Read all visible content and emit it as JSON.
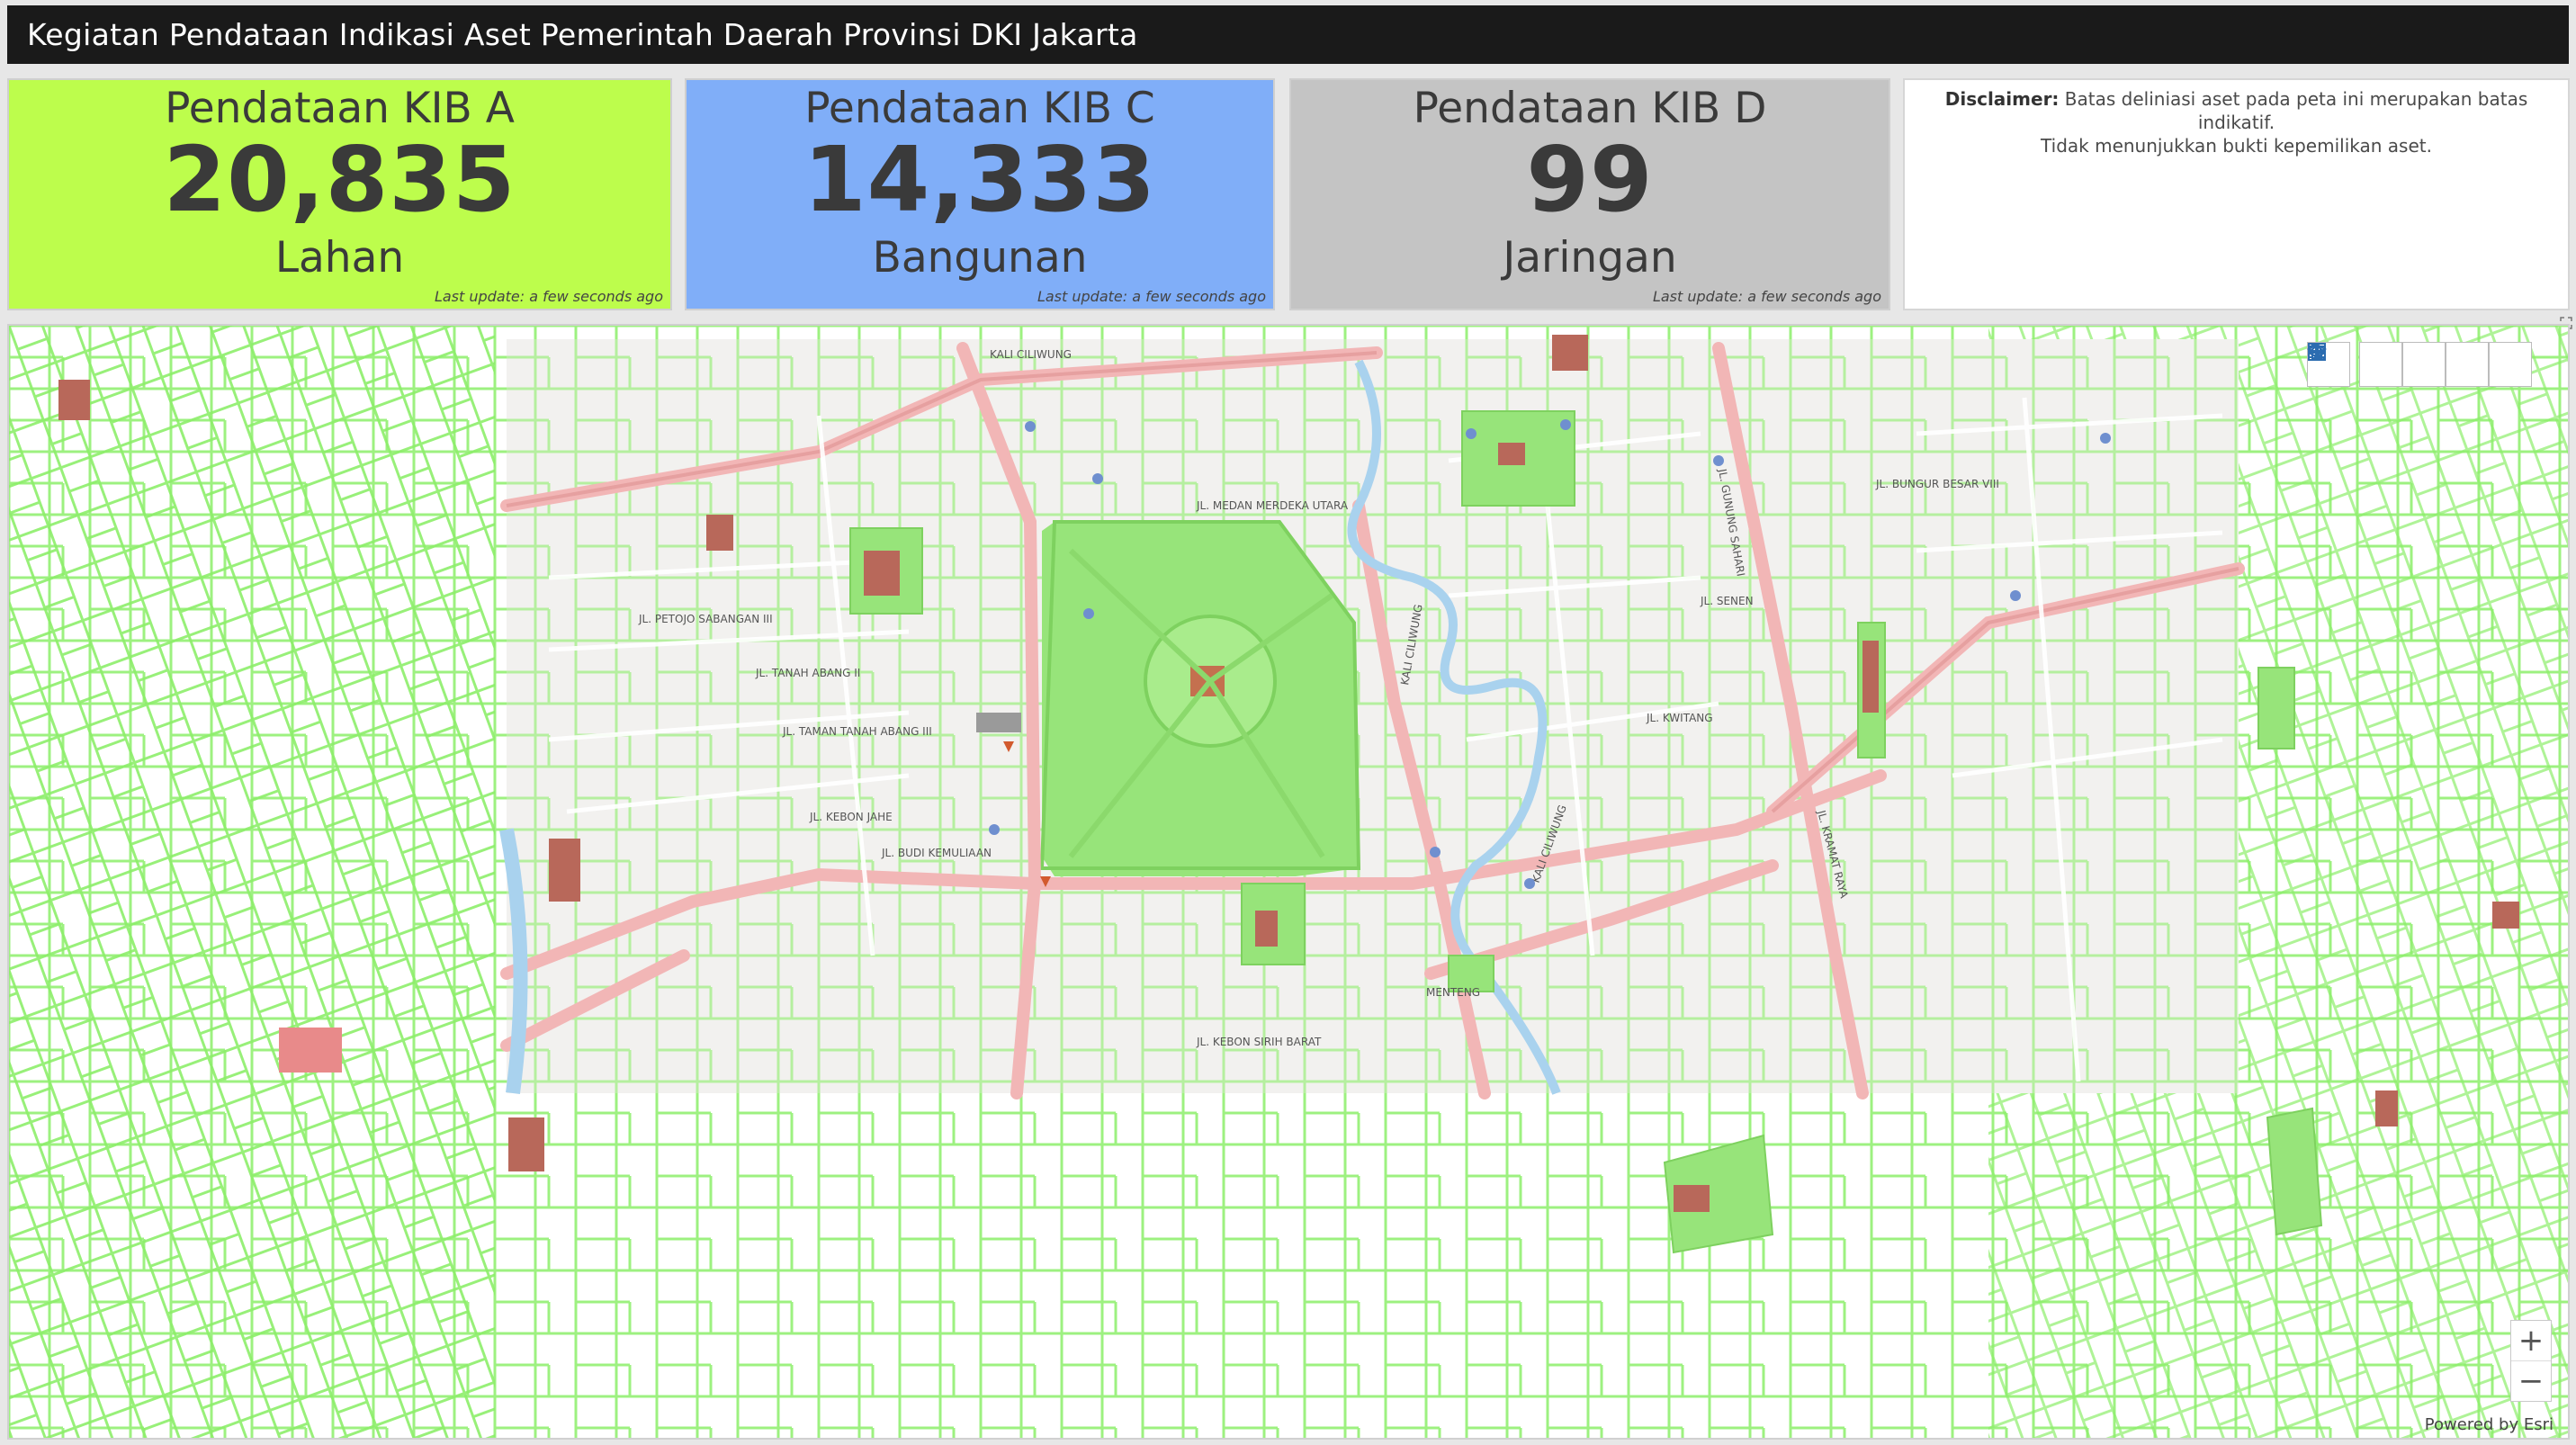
{
  "header": {
    "title": "Kegiatan Pendataan Indikasi Aset Pemerintah Daerah Provinsi DKI Jakarta"
  },
  "cards": [
    {
      "title": "Pendataan KIB A",
      "value": "20,835",
      "unit": "Lahan",
      "last_update": "Last update: a few seconds ago",
      "color": "#bdfd4c"
    },
    {
      "title": "Pendataan KIB C",
      "value": "14,333",
      "unit": "Bangunan",
      "last_update": "Last update: a few seconds ago",
      "color": "#80aef8"
    },
    {
      "title": "Pendataan KIB D",
      "value": "99",
      "unit": "Jaringan",
      "last_update": "Last update: a few seconds ago",
      "color": "#c4c4c4"
    }
  ],
  "disclaimer": {
    "label": "Disclaimer:",
    "text1": "Batas deliniasi aset pada peta ini merupakan batas indikatif.",
    "text2": "Tidak menunjukkan bukti kepemilikan aset."
  },
  "map": {
    "labels": {
      "ciliwung_top": "KALI CILIWUNG",
      "ciliwung_mid": "KALI CILIWUNG",
      "ciliwung_low": "KALI CILIWUNG",
      "medan_merdeka": "JL. MEDAN MERDEKA UTARA",
      "tanah_abang": "JL. TANAH ABANG II",
      "taman_tanah_abang": "JL. TAMAN TANAH ABANG III",
      "kebon_jahe": "JL. KEBON JAHE",
      "budi_kemuliaan": "JL. BUDI KEMULIAAN",
      "petojo_sabangan": "JL. PETOJO SABANGAN III",
      "kramat_raya": "JL. KRAMAT RAYA",
      "gunung_sahari": "JL. GUNUNG SAHARI",
      "kwitang": "JL. KWITANG",
      "kebon_sirih": "JL. KEBON SIRIH BARAT",
      "menteng": "MENTENG",
      "senen": "JL. SENEN",
      "bungur_besar": "JL. BUNGUR BESAR VIII"
    },
    "controls": {
      "search_icon": "search-icon",
      "home_icon": "home-icon",
      "legend_icon": "legend-icon",
      "layers_icon": "layers-icon",
      "basemap_icon": "basemap-icon",
      "zoom_in": "+",
      "zoom_out": "−"
    },
    "attribution": "Powered by Esri",
    "colors": {
      "parcel": "#8cee6a",
      "building": "#b8685a",
      "road": "#f2b6b6",
      "water": "#a9d2ee"
    }
  }
}
